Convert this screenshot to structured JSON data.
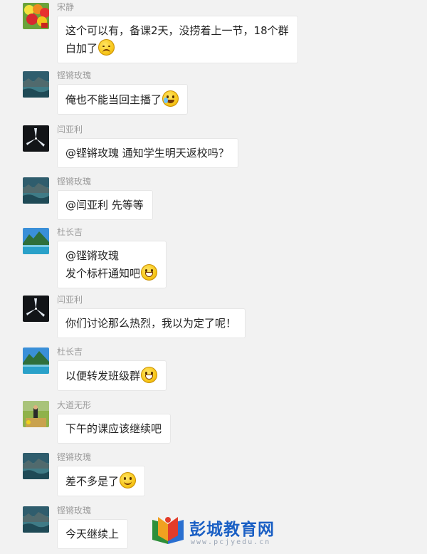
{
  "messages": [
    {
      "sender": "宋静",
      "avatar": "flowers-avatar",
      "lines": [
        "这个可以有，备课2天，没捞着上一节，18个群",
        "白加了"
      ],
      "emoji": "sweat"
    },
    {
      "sender": "铿锵玫瑰",
      "avatar": "lake-avatar",
      "lines": [
        "俺也不能当回主播了"
      ],
      "emoji": "cry"
    },
    {
      "sender": "闫亚利",
      "avatar": "windmill-avatar",
      "lines": [
        "@铿锵玫瑰 通知学生明天返校吗？"
      ],
      "emoji": ""
    },
    {
      "sender": "铿锵玫瑰",
      "avatar": "lake-avatar",
      "lines": [
        "@闫亚利 先等等"
      ],
      "emoji": ""
    },
    {
      "sender": "杜长吉",
      "avatar": "mountain-lake-avatar",
      "lines": [
        "@铿锵玫瑰",
        "发个标杆通知吧"
      ],
      "emoji": "grin"
    },
    {
      "sender": "闫亚利",
      "avatar": "windmill-avatar",
      "lines": [
        "你们讨论那么热烈，我以为定了呢！"
      ],
      "emoji": ""
    },
    {
      "sender": "杜长吉",
      "avatar": "mountain-lake-avatar",
      "lines": [
        "以便转发班级群"
      ],
      "emoji": "grin"
    },
    {
      "sender": "大道无形",
      "avatar": "outdoor-person-avatar",
      "lines": [
        "下午的课应该继续吧"
      ],
      "emoji": ""
    },
    {
      "sender": "铿锵玫瑰",
      "avatar": "lake-avatar",
      "lines": [
        "差不多是了"
      ],
      "emoji": "smile"
    },
    {
      "sender": "铿锵玫瑰",
      "avatar": "lake-avatar",
      "lines": [
        "今天继续上"
      ],
      "emoji": ""
    }
  ],
  "watermark": {
    "title": "彭城教育网",
    "url": "www.pcjyedu.cn"
  },
  "colors": {
    "background": "#f2f2f2",
    "bubble": "#ffffff",
    "name": "#9a9a9a",
    "watermark": "#1a5fc4"
  }
}
